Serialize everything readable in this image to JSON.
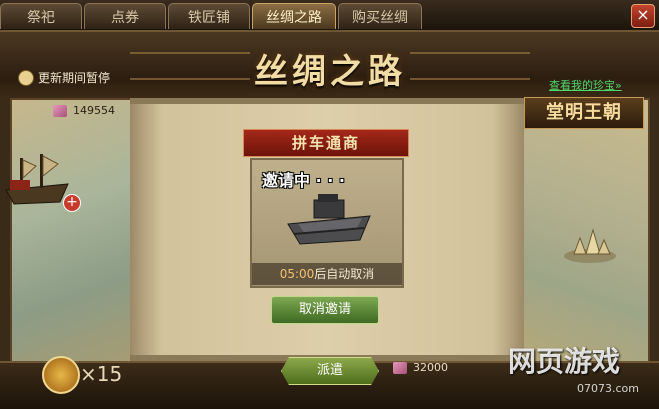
{
  "tabs": [
    {
      "label": "祭祀",
      "active": false
    },
    {
      "label": "点券",
      "active": false
    },
    {
      "label": "铁匠铺",
      "active": false
    },
    {
      "label": "丝绸之路",
      "active": true
    },
    {
      "label": "购买丝绸",
      "active": false
    }
  ],
  "close_label": "×",
  "title": "丝绸之路",
  "notice": "更新期间暂停",
  "silk_count": "149554",
  "view_treasure_link": "查看我的珍宝»",
  "dynasty": "堂明王朝",
  "banner": "拼车通商",
  "invite_status": "邀请中 · · ·",
  "auto_cancel": {
    "time": "05:00",
    "text": "后自动取消"
  },
  "cancel_invite_button": "取消邀请",
  "dispatch_button": "派遣",
  "bottom_silk": "32000",
  "token_count": "×15",
  "watermark": {
    "main": "网页游戏",
    "sub": "07073.com"
  },
  "colors": {
    "accent_gold": "#f1dca6",
    "banner_red": "#a4281a",
    "button_green": "#7ea852",
    "link_green": "#4fd86c"
  }
}
